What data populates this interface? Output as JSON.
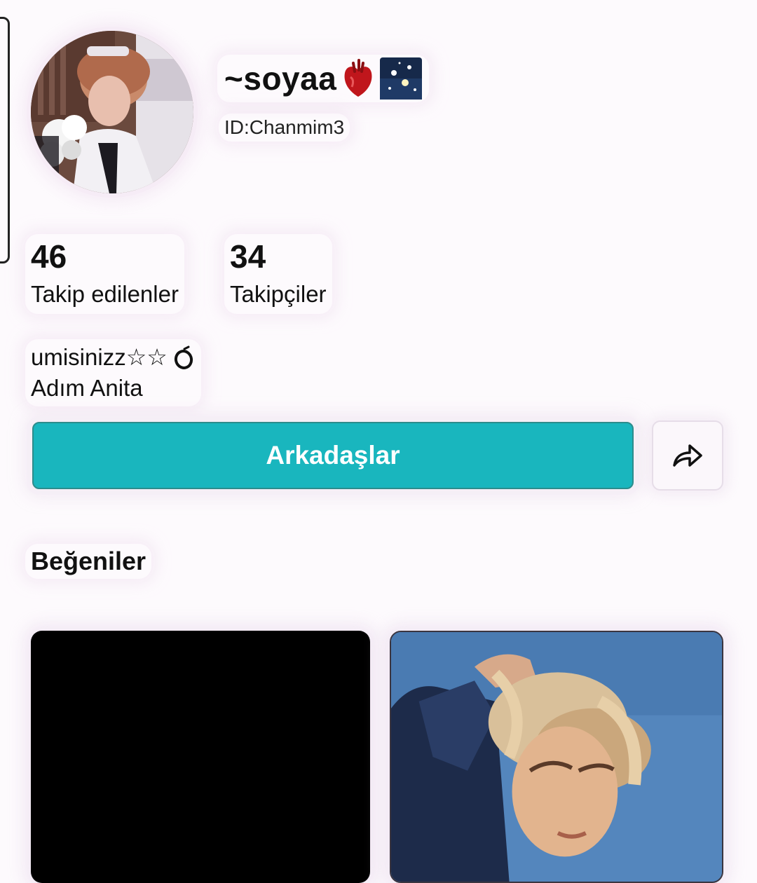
{
  "profile": {
    "username": "~soyaa",
    "username_emojis": [
      "anatomical-heart",
      "night-sky"
    ],
    "user_id": "ID:Chanmim3"
  },
  "stats": {
    "following_count": "46",
    "following_label": "Takip edilenler",
    "followers_count": "34",
    "followers_label": "Takipçiler"
  },
  "bio": {
    "line1": "umisinizz☆☆",
    "line2": "Adım Anita"
  },
  "actions": {
    "friends_label": "Arkadaşlar",
    "share_icon": "share-arrow-icon",
    "accent_color": "#19b6be"
  },
  "likes": {
    "heading": "Beğeniler",
    "items": [
      {
        "kind": "black-thumbnail"
      },
      {
        "kind": "photo-thumbnail"
      }
    ]
  }
}
